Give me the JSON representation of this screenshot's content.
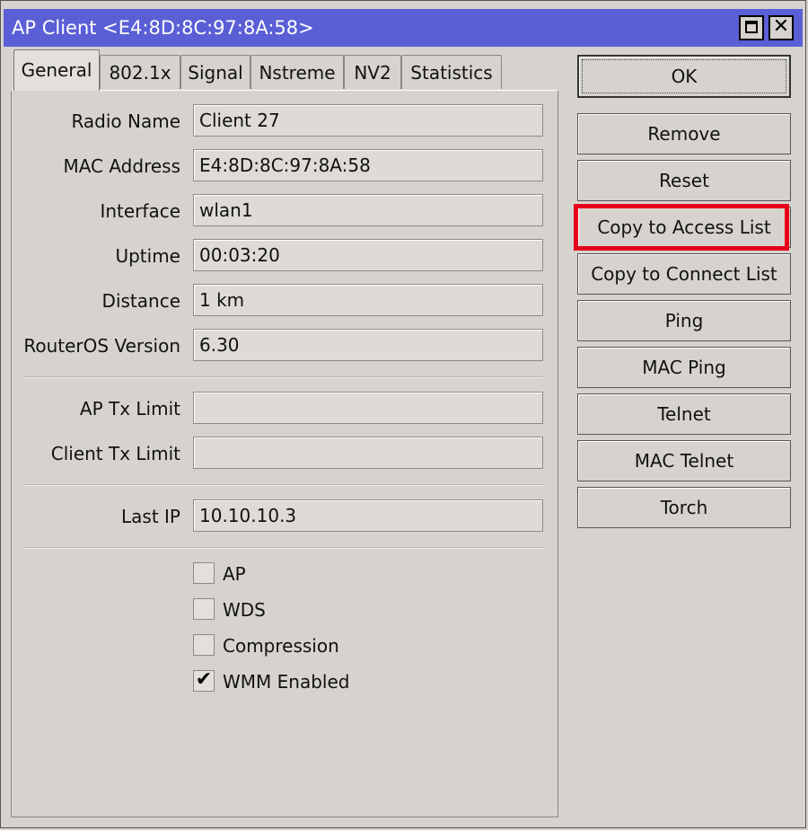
{
  "window": {
    "title": "AP Client <E4:8D:8C:97:8A:58>"
  },
  "tabs": [
    {
      "label": "General"
    },
    {
      "label": "802.1x"
    },
    {
      "label": "Signal"
    },
    {
      "label": "Nstreme"
    },
    {
      "label": "NV2"
    },
    {
      "label": "Statistics"
    }
  ],
  "fields": {
    "radio_name": {
      "label": "Radio Name",
      "value": "Client 27"
    },
    "mac_address": {
      "label": "MAC Address",
      "value": "E4:8D:8C:97:8A:58"
    },
    "interface": {
      "label": "Interface",
      "value": "wlan1"
    },
    "uptime": {
      "label": "Uptime",
      "value": "00:03:20"
    },
    "distance": {
      "label": "Distance",
      "value": "1 km"
    },
    "routeros_version": {
      "label": "RouterOS Version",
      "value": "6.30"
    },
    "ap_tx_limit": {
      "label": "AP Tx Limit",
      "value": ""
    },
    "client_tx_limit": {
      "label": "Client Tx Limit",
      "value": ""
    },
    "last_ip": {
      "label": "Last IP",
      "value": "10.10.10.3"
    }
  },
  "checkboxes": {
    "ap": {
      "label": "AP",
      "checked": false
    },
    "wds": {
      "label": "WDS",
      "checked": false
    },
    "compression": {
      "label": "Compression",
      "checked": false
    },
    "wmm": {
      "label": "WMM Enabled",
      "checked": true
    }
  },
  "buttons": {
    "ok": "OK",
    "remove": "Remove",
    "reset": "Reset",
    "copy_access": "Copy to Access List",
    "copy_connect": "Copy to Connect List",
    "ping": "Ping",
    "mac_ping": "MAC Ping",
    "telnet": "Telnet",
    "mac_telnet": "MAC Telnet",
    "torch": "Torch"
  },
  "colors": {
    "titlebar": "#5a5fd6",
    "highlight": "#e8001a",
    "window_bg": "#d6d3ce"
  }
}
